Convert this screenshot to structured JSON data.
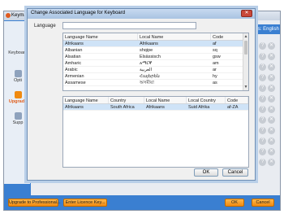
{
  "app": {
    "title": "Keyman",
    "right_header": "ts: English",
    "nav": [
      {
        "label": "Keyboard",
        "active": false
      },
      {
        "label": "Opti",
        "active": false
      },
      {
        "label": "Upgrade",
        "active": true
      },
      {
        "label": "Supp",
        "active": false
      }
    ],
    "buttons": {
      "upgrade": "Upgrade to Professional...",
      "licence": "Enter Licence Key...",
      "ok": "OK",
      "cancel": "Cancel"
    },
    "right_icons": [
      "?",
      "✕"
    ]
  },
  "dialog": {
    "title": "Change Associated Language for Keyboard",
    "close_glyph": "✕",
    "language_label": "Language",
    "language_value": "",
    "language_table": {
      "columns": [
        "Language Name",
        "Local Name",
        "Code"
      ],
      "rows": [
        [
          "Afrikaans",
          "Afrikaans",
          "af"
        ],
        [
          "Albanian",
          "shqipe",
          "sq"
        ],
        [
          "Alsatian",
          "Elsässisch",
          "gsw"
        ],
        [
          "Amharic",
          "አማርኛ",
          "am"
        ],
        [
          "Arabic",
          "العربية",
          "ar"
        ],
        [
          "Armenian",
          "Հայերեն",
          "hy"
        ],
        [
          "Assamese",
          "অসমীয়া",
          "as"
        ]
      ],
      "selected_index": 0
    },
    "locale_table": {
      "columns": [
        "Language Name",
        "Country",
        "Local Name",
        "Local Country",
        "Code"
      ],
      "rows": [
        [
          "Afrikaans",
          "South Africa",
          "Afrikaans",
          "Suid Afrika",
          "af-ZA"
        ]
      ],
      "selected_index": 0
    },
    "ok_label": "OK",
    "cancel_label": "Cancel"
  }
}
